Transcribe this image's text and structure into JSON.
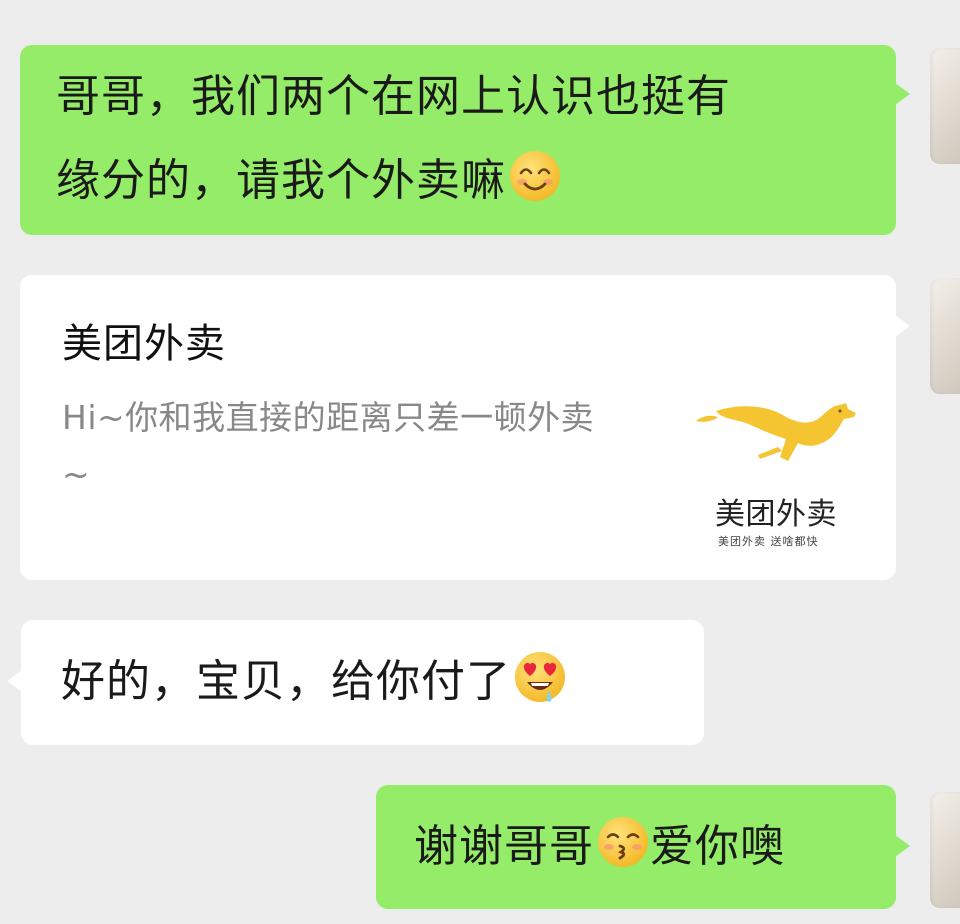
{
  "messages": [
    {
      "side": "right",
      "kind": "text",
      "line1": "哥哥，我们两个在网上认识也挺有",
      "line2": "缘分的，请我个外卖嘛",
      "emoji": "smiling-face-with-smiling-eyes"
    },
    {
      "side": "right",
      "kind": "mini-program-card",
      "card": {
        "title": "美团外卖",
        "description": "Hi~你和我直接的距离只差一顿外卖 ~",
        "logo": {
          "icon": "yellow-kangaroo-logo",
          "name": "美团外卖",
          "slogan": "美团外卖 送啥都快"
        }
      }
    },
    {
      "side": "left",
      "kind": "text",
      "text": "好的，宝贝，给你付了",
      "emoji": "heart-eyes-drooling-face"
    },
    {
      "side": "right",
      "kind": "text",
      "text_before": "谢谢哥哥",
      "emoji": "kissing-face",
      "text_after": "爱你噢"
    }
  ],
  "colors": {
    "background": "#ededed",
    "sent_bubble": "#95ec69",
    "card_bubble": "#ffffff",
    "received_bubble": "#ffffff",
    "brand_yellow": "#f5c431"
  }
}
